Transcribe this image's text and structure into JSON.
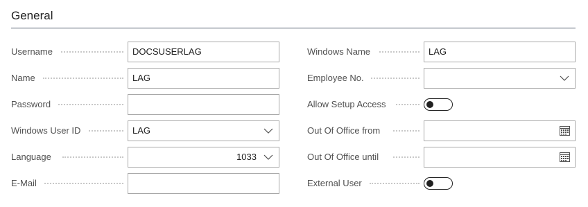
{
  "section": {
    "title": "General"
  },
  "left": {
    "username": {
      "label": "Username",
      "value": "DOCSUSERLAG"
    },
    "name": {
      "label": "Name",
      "value": "LAG"
    },
    "password": {
      "label": "Password",
      "value": ""
    },
    "windows_user_id": {
      "label": "Windows User ID",
      "value": "LAG"
    },
    "language": {
      "label": "Language",
      "value": "1033"
    },
    "email": {
      "label": "E-Mail",
      "value": ""
    }
  },
  "right": {
    "windows_name": {
      "label": "Windows Name",
      "value": "LAG"
    },
    "employee_no": {
      "label": "Employee No.",
      "value": ""
    },
    "allow_setup_access": {
      "label": "Allow Setup Access",
      "on": false
    },
    "out_of_office_from": {
      "label": "Out Of Office from",
      "value": ""
    },
    "out_of_office_until": {
      "label": "Out Of Office until",
      "value": ""
    },
    "external_user": {
      "label": "External User",
      "on": false
    }
  }
}
